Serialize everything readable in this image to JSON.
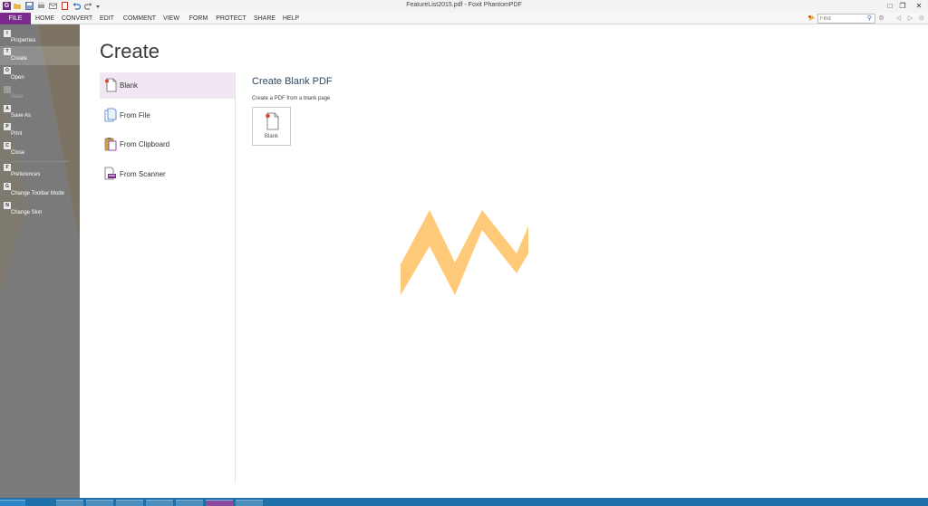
{
  "window": {
    "title": "FeatureList2015.pdf - Foxit PhantomPDF",
    "app_logo_letter": "G",
    "controls": [
      "restore-down-icon",
      "restore-icon",
      "close-icon"
    ]
  },
  "ribbon": {
    "tabs": [
      {
        "label": "FILE",
        "active": true
      },
      {
        "label": "HOME"
      },
      {
        "label": "CONVERT"
      },
      {
        "label": "EDIT"
      },
      {
        "label": "COMMENT"
      },
      {
        "label": "VIEW"
      },
      {
        "label": "FORM"
      },
      {
        "label": "PROTECT"
      },
      {
        "label": "SHARE"
      },
      {
        "label": "HELP"
      }
    ],
    "find": {
      "placeholder": "Find"
    }
  },
  "backstage": {
    "items": [
      {
        "key": "I",
        "label": "Properties"
      },
      {
        "key": "T",
        "label": "Create",
        "selected": true
      },
      {
        "key": "O",
        "label": "Open"
      },
      {
        "key": "",
        "label": "Save",
        "disabled": true
      },
      {
        "key": "A",
        "label": "Save As"
      },
      {
        "key": "P",
        "label": "Print"
      },
      {
        "key": "C",
        "label": "Close"
      },
      {
        "key": "F",
        "label": "Preferences"
      },
      {
        "key": "G",
        "label": "Change Toolbar Mode"
      },
      {
        "key": "N",
        "label": "Change Skin"
      }
    ]
  },
  "main": {
    "title": "Create",
    "options": [
      {
        "label": "Blank",
        "icon": "blank-page-icon",
        "selected": true
      },
      {
        "label": "From File",
        "icon": "file-page-icon"
      },
      {
        "label": "From Clipboard",
        "icon": "clipboard-icon"
      },
      {
        "label": "From Scanner",
        "icon": "scanner-icon"
      }
    ],
    "detail": {
      "title": "Create Blank PDF",
      "description": "Create a PDF from a blank page",
      "tile_label": "Blank"
    }
  },
  "colors": {
    "accent": "#7b2b8e",
    "backstage": "#6b6b6b",
    "watermark": "#ffc97a",
    "taskbar": "#1f6fa8"
  }
}
